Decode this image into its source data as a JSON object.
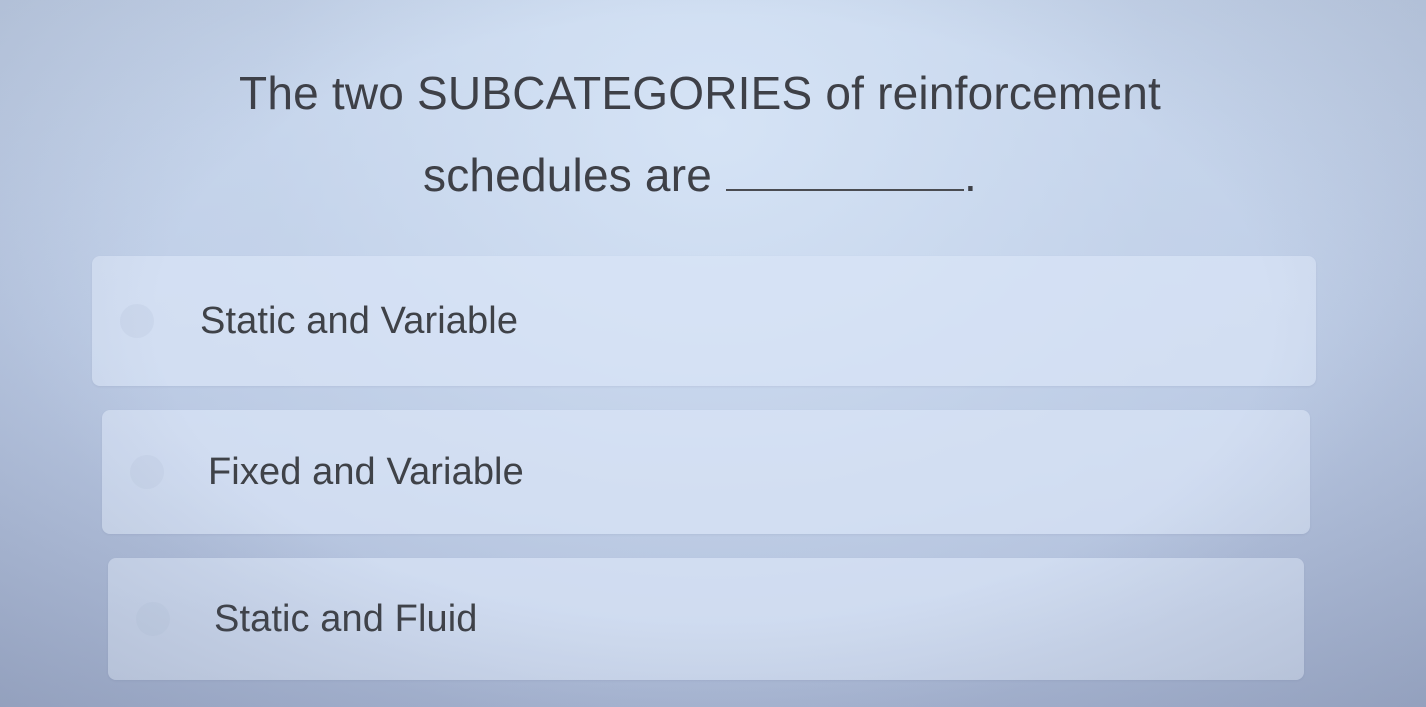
{
  "question": {
    "line1": "The two SUBCATEGORIES of reinforcement",
    "line2": "schedules are",
    "end_punct": "."
  },
  "options": [
    {
      "label": "Static and Variable"
    },
    {
      "label": "Fixed and Variable"
    },
    {
      "label": "Static and Fluid"
    }
  ]
}
